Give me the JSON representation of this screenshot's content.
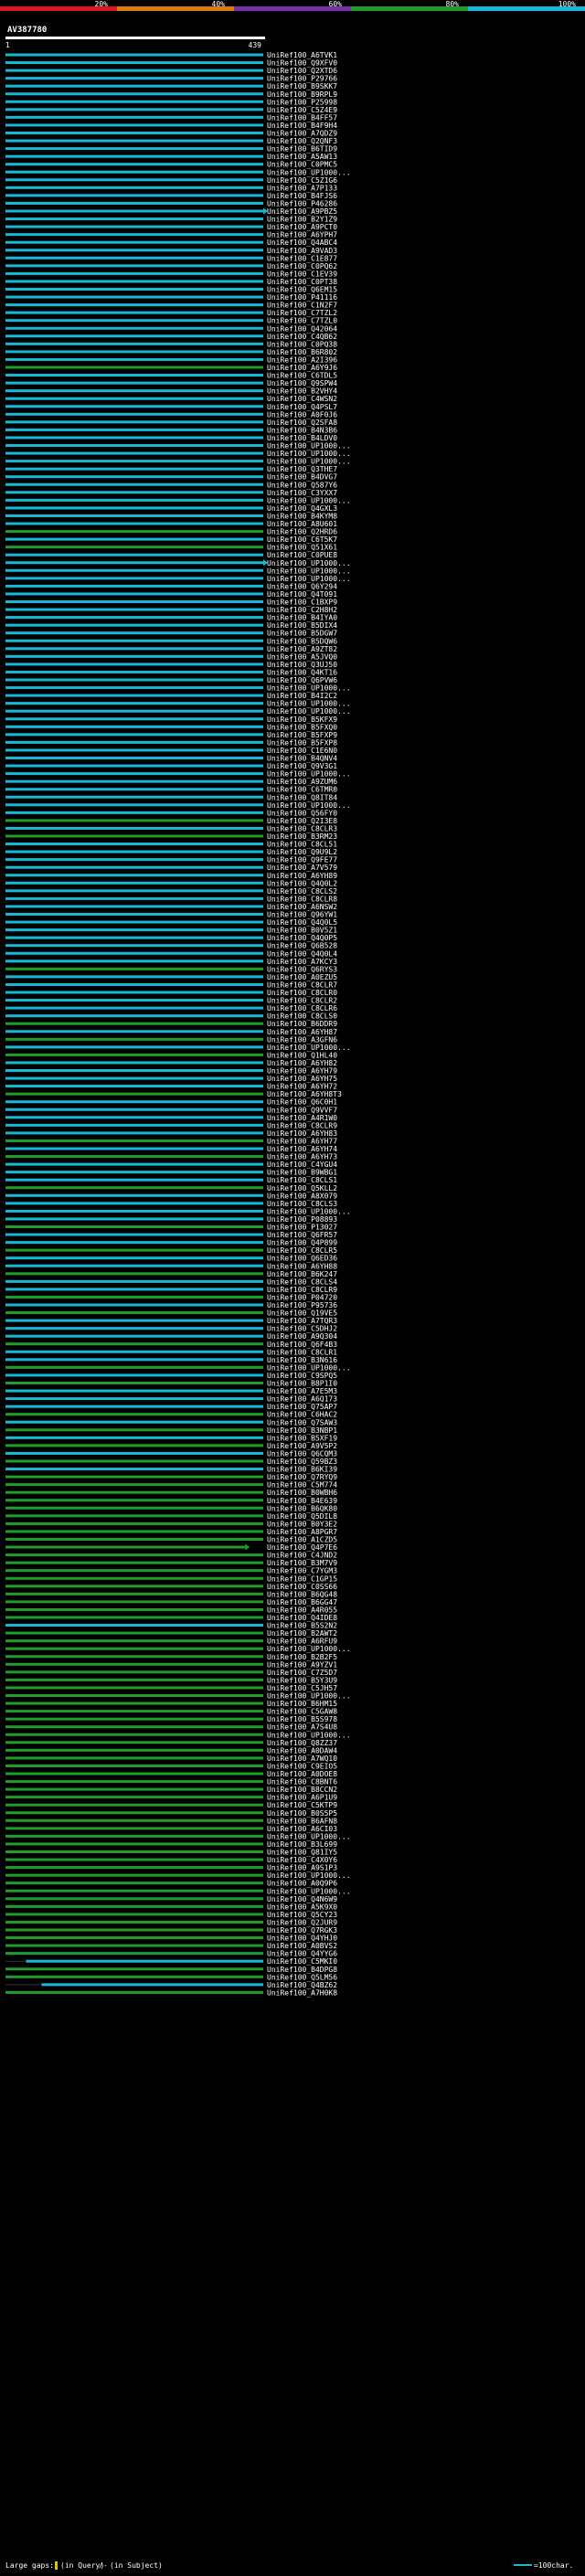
{
  "header": {
    "scale_ticks": [
      "20%",
      "40%",
      "60%",
      "80%",
      "100%"
    ],
    "scale_colors": [
      "#e0141e",
      "#e07b14",
      "#7b2fa8",
      "#1f9e2a",
      "#15b9d6"
    ],
    "query_id": "AV387780",
    "start_label": "1",
    "end_label": "439"
  },
  "legend": {
    "large_gaps_label": "Large gaps:",
    "in_query_label": "(in Query)",
    "separator": "/",
    "in_subject_label": "(in Subject)",
    "scale_label": "=100char."
  },
  "chart_data": {
    "type": "alignment_overview",
    "query_length": 439,
    "series_colors": {
      "high": "#15b9d6",
      "mid": "#1f9e2a"
    },
    "subjects": [
      "UniRef100_A6TVK1",
      "UniRef100_Q9XFV0",
      "UniRef100_Q2XTD6",
      "UniRef100_P29766",
      "UniRef100_B9SKK7",
      "UniRef100_B9RPL9",
      "UniRef100_P25998",
      "UniRef100_C5Z4E9",
      "UniRef100_B4FF57",
      "UniRef100_B4F9H4",
      "UniRef100_A7QDZ9",
      "UniRef100_Q2QNF3",
      "UniRef100_B6TID9",
      "UniRef100_A5AW13",
      "UniRef100_C0PMC5",
      "UniRef100_UP1000...",
      "UniRef100_C5Z1G6",
      "UniRef100_A7P133",
      "UniRef100_B4FJS6",
      "UniRef100_P46286",
      "UniRef100_A9PBZ5",
      "UniRef100_B2Y1Z9",
      "UniRef100_A9PCT0",
      "UniRef100_A6YPH7",
      "UniRef100_Q4ABC4",
      "UniRef100_A9VAD3",
      "UniRef100_C1E877",
      "UniRef100_C0PQ62",
      "UniRef100_C1EV39",
      "UniRef100_C0PT38",
      "UniRef100_Q6EM15",
      "UniRef100_P41116",
      "UniRef100_C1N2F7",
      "UniRef100_C7TZL2",
      "UniRef100_C7TZL0",
      "UniRef100_Q42064",
      "UniRef100_C4QB62",
      "UniRef100_C0PQ38",
      "UniRef100_B6R802",
      "UniRef100_A2I396",
      "UniRef100_A6Y9J6",
      "UniRef100_C6TDL5",
      "UniRef100_Q9SPW4",
      "UniRef100_B2VHY4",
      "UniRef100_C4WSN2",
      "UniRef100_Q4PSL7",
      "UniRef100_A0F0J6",
      "UniRef100_Q2SFA8",
      "UniRef100_B4N3B6",
      "UniRef100_B4LDV0",
      "UniRef100_UP1000...",
      "UniRef100_UP1000...",
      "UniRef100_UP1000...",
      "UniRef100_Q3THE7",
      "UniRef100_B4DVG7",
      "UniRef100_Q587Y6",
      "UniRef100_C3YXX7",
      "UniRef100_UP1000...",
      "UniRef100_Q4GXL3",
      "UniRef100_B4KYM8",
      "UniRef100_A8U601",
      "UniRef100_Q2HRD6",
      "UniRef100_C6T5K7",
      "UniRef100_Q51X61",
      "UniRef100_C0PUE8",
      "UniRef100_UP1000...",
      "UniRef100_UP1000...",
      "UniRef100_UP1000...",
      "UniRef100_Q6Y294",
      "UniRef100_Q4T091",
      "UniRef100_C1BXP9",
      "UniRef100_C2H8H2",
      "UniRef100_B4IYA0",
      "UniRef100_B5DIX4",
      "UniRef100_B5DGW7",
      "UniRef100_B5DQW6",
      "UniRef100_A9ZT82",
      "UniRef100_A5JVQ0",
      "UniRef100_Q3UJ50",
      "UniRef100_Q4KT16",
      "UniRef100_Q6PVW6",
      "UniRef100_UP1000...",
      "UniRef100_B4I2C2",
      "UniRef100_UP1000...",
      "UniRef100_UP1000...",
      "UniRef100_B5KFX9",
      "UniRef100_B5FXQ0",
      "UniRef100_B5FXP9",
      "UniRef100_B5FXP8",
      "UniRef100_C1E6N0",
      "UniRef100_B4QNV4",
      "UniRef100_Q9V3G1",
      "UniRef100_UP1000...",
      "UniRef100_A9ZUM6",
      "UniRef100_C6TMR0",
      "UniRef100_Q8IT84",
      "UniRef100_UP1000...",
      "UniRef100_Q56FY0",
      "UniRef100_Q2I3E8",
      "UniRef100_C8CLR3",
      "UniRef100_B3RM23",
      "UniRef100_C8CL51",
      "UniRef100_Q9U9L2",
      "UniRef100_Q9FE77",
      "UniRef100_A7V579",
      "UniRef100_A6YH89",
      "UniRef100_Q4Q0L2",
      "UniRef100_C8CLS2",
      "UniRef100_C8CLR8",
      "UniRef100_A6NSW2",
      "UniRef100_Q96YW1",
      "UniRef100_Q4Q0L5",
      "UniRef100_B0V5Z1",
      "UniRef100_Q4Q0P5",
      "UniRef100_Q6B528",
      "UniRef100_Q4Q0L4",
      "UniRef100_A7KCY3",
      "UniRef100_Q6RYS3",
      "UniRef100_A0EZU5",
      "UniRef100_C8CLR7",
      "UniRef100_C8CLR0",
      "UniRef100_C8CLR2",
      "UniRef100_C8CLR6",
      "UniRef100_C8CLS0",
      "UniRef100_B6DDR9",
      "UniRef100_A6YH87",
      "UniRef100_A3GFN6",
      "UniRef100_UP1000...",
      "UniRef100_Q1HL40",
      "UniRef100_A6YH82",
      "UniRef100_A6YH79",
      "UniRef100_A6YH75",
      "UniRef100_A6YH72",
      "UniRef100_A6YH8T3",
      "UniRef100_Q6C0H1",
      "UniRef100_Q9VVF7",
      "UniRef100_A4R1W0",
      "UniRef100_C8CLR9",
      "UniRef100_A6YH83",
      "UniRef100_A6YH77",
      "UniRef100_A6YH74",
      "UniRef100_A6YH73",
      "UniRef100_C4YGU4",
      "UniRef100_B9WBG1",
      "UniRef100_C8CLS1",
      "UniRef100_Q5KLL2",
      "UniRef100_A8X079",
      "UniRef100_C8CLS3",
      "UniRef100_UP1000...",
      "UniRef100_P08893",
      "UniRef100_P13027",
      "UniRef100_Q6FR57",
      "UniRef100_Q4P899",
      "UniRef100_C8CLR5",
      "UniRef100_Q6ED36",
      "UniRef100_A6YH88",
      "UniRef100_B6K247",
      "UniRef100_C8CLS4",
      "UniRef100_C8CLR9",
      "UniRef100_P04720",
      "UniRef100_P95736",
      "UniRef100_Q19VE5",
      "UniRef100_A7TQR3",
      "UniRef100_C5DHJ2",
      "UniRef100_A9Q304",
      "UniRef100_Q6F4B3",
      "UniRef100_C8CLR1",
      "UniRef100_B3N616",
      "UniRef100_UP1000...",
      "UniRef100_C9SPQ5",
      "UniRef100_B8P1I0",
      "UniRef100_A7E5M3",
      "UniRef100_A6Q173",
      "UniRef100_Q75AP7",
      "UniRef100_C6HAC2",
      "UniRef100_Q7SAW3",
      "UniRef100_B3NBP1",
      "UniRef100_B5XF19",
      "UniRef100_A9V5P2",
      "UniRef100_Q6CQM3",
      "UniRef100_Q59BZ3",
      "UniRef100_B6KI39",
      "UniRef100_Q7RYQ9",
      "UniRef100_C5M774",
      "UniRef100_B0WBH6",
      "UniRef100_B4E639",
      "UniRef100_B6QK80",
      "UniRef100_Q5DIL8",
      "UniRef100_B0Y3E2",
      "UniRef100_A8PGR7",
      "UniRef100_A1CZD5",
      "UniRef100_Q4P7E6",
      "UniRef100_C4JND2",
      "UniRef100_B3M7V9",
      "UniRef100_C7YGM3",
      "UniRef100_C1GP15",
      "UniRef100_C0SS66",
      "UniRef100_B6QG48",
      "UniRef100_B6GG47",
      "UniRef100_A4R055",
      "UniRef100_Q4IDE8",
      "UniRef100_B5S2N2",
      "UniRef100_B2AWT2",
      "UniRef100_A6RFU9",
      "UniRef100_UP1000...",
      "UniRef100_B2B2F5",
      "UniRef100_A9YZV1",
      "UniRef100_C7Z5D7",
      "UniRef100_B5Y3U9",
      "UniRef100_C5JH57",
      "UniRef100_UP1000...",
      "UniRef100_B6HM15",
      "UniRef100_C5GAW8",
      "UniRef100_B5S978",
      "UniRef100_A7S4U8",
      "UniRef100_UP1000...",
      "UniRef100_Q8ZZ37",
      "UniRef100_A0DAW4",
      "UniRef100_A7WQ10",
      "UniRef100_C9EIO5",
      "UniRef100_A0DOE8",
      "UniRef100_C8BNT6",
      "UniRef100_B8CCN2",
      "UniRef100_A6P1U9",
      "UniRef100_C5KTP9",
      "UniRef100_B0S5P5",
      "UniRef100_B6AFN8",
      "UniRef100_A6CI03",
      "UniRef100_UP1000...",
      "UniRef100_B3L699",
      "UniRef100_Q81IY5",
      "UniRef100_C4X0Y6",
      "UniRef100_A9S1P3",
      "UniRef100_UP1000...",
      "UniRef100_A0Q9P6",
      "UniRef100_UP1000...",
      "UniRef100_Q4N6W9",
      "UniRef100_A5K9X0",
      "UniRef100_Q5CY23",
      "UniRef100_Q2JUR9",
      "UniRef100_Q7RGK3",
      "UniRef100_Q4YHJ0",
      "UniRef100_A0BVS2",
      "UniRef100_Q4YYG6",
      "UniRef100_C5MKI0",
      "UniRef100_B4DPG8",
      "UniRef100_Q5LM56",
      "UniRef100_Q4BZ62",
      "UniRef100_A7H0K8"
    ],
    "tier_breaks": {
      "cyan_until": 182,
      "mixed": [
        [
          40,
          "g"
        ],
        [
          61,
          "g"
        ],
        [
          63,
          "g"
        ],
        [
          98,
          "g"
        ],
        [
          100,
          "g"
        ],
        [
          117,
          "g"
        ],
        [
          124,
          "g"
        ],
        [
          126,
          "g"
        ],
        [
          128,
          "g"
        ],
        [
          133,
          "g"
        ],
        [
          139,
          "g"
        ],
        [
          141,
          "g"
        ],
        [
          145,
          "g"
        ],
        [
          150,
          "g"
        ],
        [
          153,
          "g"
        ],
        [
          156,
          "g"
        ],
        [
          159,
          "g"
        ],
        [
          161,
          "g"
        ],
        [
          165,
          "g"
        ],
        [
          168,
          "g"
        ],
        [
          170,
          "g"
        ],
        [
          174,
          "g"
        ],
        [
          176,
          "g"
        ],
        [
          178,
          "g"
        ],
        [
          180,
          "g"
        ]
      ]
    },
    "overrides": {
      "20": [
        0,
        100,
        "x"
      ],
      "65": [
        0,
        100,
        "x"
      ],
      "191": [
        0,
        93,
        "x"
      ],
      "201": [
        0,
        100,
        "c"
      ],
      "255": [
        0,
        100,
        "c"
      ],
      "269": [
        0,
        85,
        "x"
      ],
      "286": [
        0,
        81,
        "x"
      ],
      "292": [
        0,
        92,
        "x"
      ],
      "302": [
        0,
        84,
        "x"
      ],
      "244": [
        8,
        100,
        "c"
      ],
      "247": [
        14,
        100,
        "c"
      ],
      "249": [
        12,
        100,
        "c"
      ],
      "258": [
        17,
        100,
        "c"
      ],
      "262": [
        17,
        100,
        "c"
      ],
      "263": [
        17,
        100,
        "c"
      ],
      "278": [
        17,
        100,
        "c"
      ],
      "301": [
        23,
        100,
        "c"
      ]
    }
  }
}
